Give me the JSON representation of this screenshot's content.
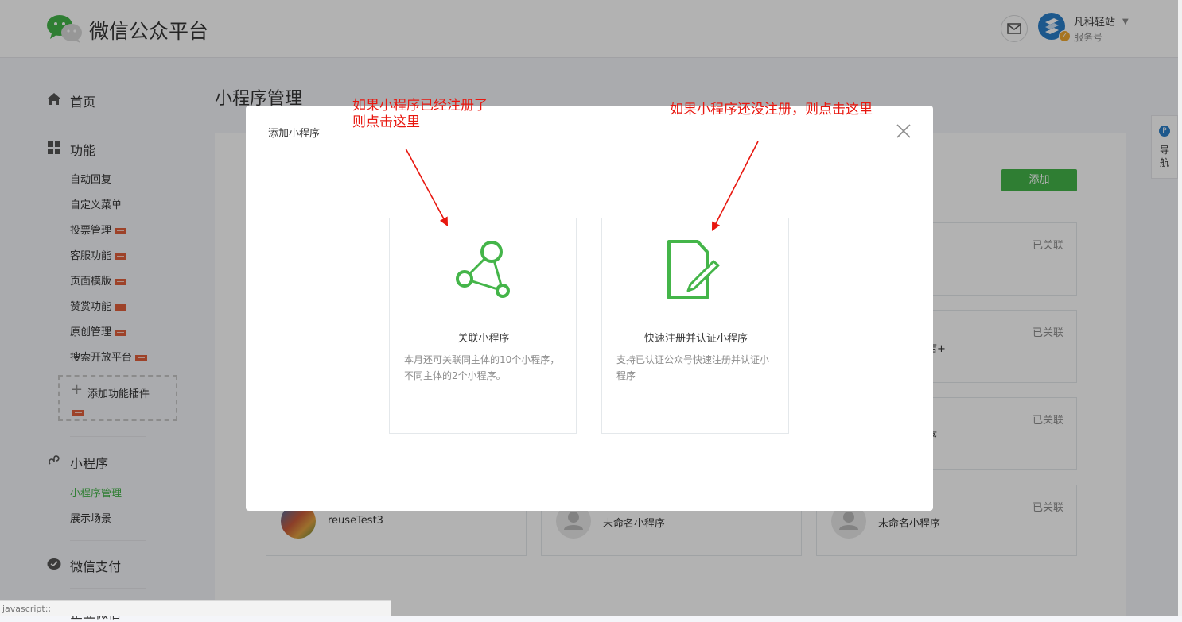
{
  "header": {
    "logo_text": "微信公众平台",
    "account_name": "凡科轻站",
    "account_type": "服务号"
  },
  "sidebar": {
    "home": "首页",
    "features": "功能",
    "feature_items": [
      "自动回复",
      "自定义菜单",
      "投票管理",
      "客服功能",
      "页面模版",
      "赞赏功能",
      "原创管理",
      "搜索开放平台"
    ],
    "add_plugin": "添加功能插件",
    "miniprogram": "小程序",
    "miniprogram_items": [
      "小程序管理",
      "展示场景"
    ],
    "wechat_pay": "微信支付",
    "enterprise_wechat": "企业微信"
  },
  "main": {
    "page_title": "小程序管理",
    "add_button": "添加",
    "status_linked": "已关联",
    "cards": [
      {
        "name": "",
        "status": "已关联"
      },
      {
        "name": "店+",
        "status": "已关联"
      },
      {
        "name": "序",
        "status": "已关联"
      },
      {
        "name": "reuseTest3",
        "status": ""
      },
      {
        "name": "未命名小程序",
        "status": ""
      },
      {
        "name": "未命名小程序",
        "status": "已关联"
      }
    ]
  },
  "modal": {
    "title": "添加小程序",
    "option_link": {
      "title": "关联小程序",
      "desc": "本月还可关联同主体的10个小程序，不同主体的2个小程序。"
    },
    "option_register": {
      "title": "快速注册并认证小程序",
      "desc": "支持已认证公众号快速注册并认证小程序"
    }
  },
  "annotations": {
    "left_line1": "如果小程序已经注册了",
    "left_line2": "则点击这里",
    "right": "如果小程序还没注册，则点击这里"
  },
  "float_nav": {
    "label_1": "导",
    "label_2": "航",
    "badge": "P"
  },
  "status_bar": "javascript:;",
  "colors": {
    "brand_green": "#44b549",
    "annotation_red": "#e8170f"
  }
}
